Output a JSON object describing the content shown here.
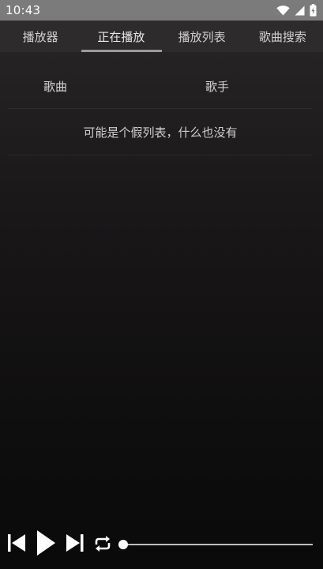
{
  "status_bar": {
    "time": "10:43",
    "icons": [
      "wifi-icon",
      "signal-icon",
      "battery-icon"
    ]
  },
  "tabs": [
    {
      "label": "播放器",
      "active": false
    },
    {
      "label": "正在播放",
      "active": true
    },
    {
      "label": "播放列表",
      "active": false
    },
    {
      "label": "歌曲搜索",
      "active": false
    }
  ],
  "list": {
    "columns": {
      "song": "歌曲",
      "artist": "歌手"
    },
    "empty_message": "可能是个假列表，什么也没有"
  },
  "player": {
    "buttons": [
      "skip-previous-icon",
      "play-icon",
      "skip-next-icon",
      "loop-icon"
    ],
    "progress": 0.0
  },
  "colors": {
    "status_bar": "#7b7b7b",
    "tab_bar": "#2e2b2d",
    "tab_indicator": "#9d9a9c",
    "text": "#d6d6d6",
    "seek_track": "#bdbdbd"
  }
}
